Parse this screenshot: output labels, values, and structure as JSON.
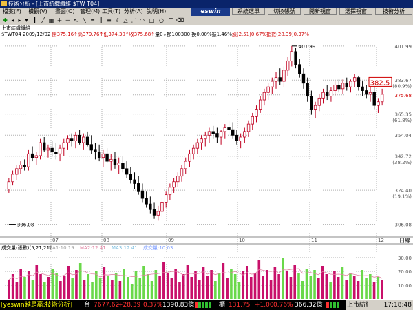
{
  "window": {
    "title": "技術分析 - [上市紡織纖維 $TW T04]"
  },
  "menu": {
    "items": [
      "檔案(F)",
      "橫觀(V)",
      "畫面(O)",
      "管理(M)",
      "工具(T)",
      "分析(A)",
      "說明(H)"
    ],
    "logo": "eswin",
    "right_buttons": [
      "系統選單",
      "切換帳號",
      "開新視窗",
      "選擇視窗",
      "技術分析"
    ]
  },
  "info": {
    "name": "上市紡織纖維",
    "line2": [
      {
        "t": "$TWT04 2009/12/02 ",
        "c": "k"
      },
      {
        "t": "開375.16↑",
        "c": "r"
      },
      {
        "t": "高379.76↑",
        "c": "r"
      },
      {
        "t": "低374.30↑",
        "c": "r"
      },
      {
        "t": "收375.68↑",
        "c": "r"
      },
      {
        "t": "量0↓",
        "c": "k"
      },
      {
        "t": "額100300 ",
        "c": "k"
      },
      {
        "t": "換0.00%",
        "c": "k"
      },
      {
        "t": "振1.46%",
        "c": "k"
      },
      {
        "t": "漲(2.51)0.67%",
        "c": "r"
      },
      {
        "t": "指數(28.39)0.37%",
        "c": "r"
      }
    ]
  },
  "chart_data": {
    "type": "candlestick",
    "price_axis": {
      "min": 306.08,
      "max": 401.99,
      "ticks": [
        "401.99",
        "383.67",
        "(80.9%)",
        "375.68",
        "365.35",
        "(61.8%)",
        "354.04",
        "342.72",
        "(38.2%)",
        "324.40",
        "(19.1%)",
        "306.08"
      ]
    },
    "annotations": {
      "high": "401.99",
      "low": "306.08",
      "current_box": "382.5"
    },
    "x_labels": [
      "07",
      "08",
      "09",
      "10",
      "11",
      "12"
    ],
    "x_axis_label": "日線",
    "volume_title": "成交量(張數)(5,21,21)",
    "volume_ma": [
      "MA1:10.19",
      "MA2:12.41",
      "MA3:12.41",
      "成交量:10.03"
    ],
    "volume_axis": [
      "30.00",
      "20.00",
      "10.00"
    ],
    "candles": [
      [
        325,
        331,
        323,
        329
      ],
      [
        329,
        335,
        327,
        333
      ],
      [
        333,
        338,
        330,
        336
      ],
      [
        336,
        340,
        333,
        338
      ],
      [
        338,
        341,
        335,
        337
      ],
      [
        337,
        346,
        335,
        344
      ],
      [
        344,
        348,
        340,
        342
      ],
      [
        342,
        345,
        338,
        343
      ],
      [
        343,
        352,
        341,
        350
      ],
      [
        350,
        353,
        345,
        346
      ],
      [
        346,
        349,
        342,
        347
      ],
      [
        347,
        351,
        343,
        345
      ],
      [
        345,
        350,
        341,
        344
      ],
      [
        344,
        349,
        340,
        347
      ],
      [
        347,
        352,
        343,
        350
      ],
      [
        350,
        354,
        346,
        352
      ],
      [
        352,
        355,
        348,
        351
      ],
      [
        351,
        356,
        347,
        354
      ],
      [
        354,
        357,
        349,
        350
      ],
      [
        350,
        355,
        346,
        353
      ],
      [
        353,
        356,
        348,
        349
      ],
      [
        349,
        354,
        344,
        346
      ],
      [
        346,
        350,
        341,
        345
      ],
      [
        345,
        349,
        340,
        342
      ],
      [
        342,
        346,
        337,
        344
      ],
      [
        344,
        347,
        339,
        340
      ],
      [
        340,
        344,
        335,
        341
      ],
      [
        341,
        345,
        336,
        338
      ],
      [
        338,
        342,
        333,
        339
      ],
      [
        339,
        343,
        334,
        336
      ],
      [
        336,
        340,
        331,
        333
      ],
      [
        333,
        337,
        328,
        330
      ],
      [
        330,
        334,
        325,
        328
      ],
      [
        328,
        332,
        322,
        324
      ],
      [
        324,
        328,
        318,
        320
      ],
      [
        320,
        324,
        315,
        317
      ],
      [
        317,
        321,
        312,
        314
      ],
      [
        314,
        318,
        309,
        311
      ],
      [
        311,
        316,
        308,
        313
      ],
      [
        313,
        320,
        310,
        318
      ],
      [
        318,
        324,
        315,
        322
      ],
      [
        322,
        328,
        319,
        326
      ],
      [
        326,
        331,
        323,
        329
      ],
      [
        329,
        334,
        326,
        332
      ],
      [
        332,
        338,
        329,
        336
      ],
      [
        336,
        342,
        333,
        340
      ],
      [
        340,
        346,
        337,
        344
      ],
      [
        344,
        349,
        341,
        347
      ],
      [
        347,
        352,
        344,
        350
      ],
      [
        350,
        354,
        346,
        352
      ],
      [
        352,
        356,
        348,
        354
      ],
      [
        354,
        358,
        350,
        356
      ],
      [
        356,
        359,
        352,
        355
      ],
      [
        355,
        358,
        350,
        353
      ],
      [
        353,
        357,
        349,
        356
      ],
      [
        356,
        360,
        352,
        358
      ],
      [
        358,
        362,
        354,
        357
      ],
      [
        357,
        361,
        352,
        354
      ],
      [
        354,
        357,
        349,
        351
      ],
      [
        351,
        355,
        347,
        353
      ],
      [
        353,
        358,
        350,
        356
      ],
      [
        356,
        362,
        353,
        360
      ],
      [
        360,
        366,
        357,
        364
      ],
      [
        364,
        370,
        361,
        368
      ],
      [
        368,
        375,
        366,
        373
      ],
      [
        373,
        379,
        370,
        377
      ],
      [
        377,
        382,
        373,
        380
      ],
      [
        380,
        385,
        376,
        383
      ],
      [
        383,
        388,
        379,
        385
      ],
      [
        385,
        390,
        381,
        383
      ],
      [
        383,
        391,
        380,
        389
      ],
      [
        389,
        396,
        386,
        394
      ],
      [
        394,
        402,
        391,
        399
      ],
      [
        399,
        401,
        390,
        392
      ],
      [
        392,
        395,
        385,
        387
      ],
      [
        387,
        390,
        379,
        382
      ],
      [
        382,
        385,
        372,
        375
      ],
      [
        375,
        378,
        365,
        368
      ],
      [
        368,
        372,
        363,
        370
      ],
      [
        370,
        376,
        367,
        374
      ],
      [
        374,
        379,
        371,
        377
      ],
      [
        377,
        381,
        373,
        375
      ],
      [
        375,
        380,
        372,
        378
      ],
      [
        378,
        383,
        375,
        381
      ],
      [
        381,
        384,
        377,
        379
      ],
      [
        379,
        384,
        376,
        382
      ],
      [
        382,
        385,
        378,
        380
      ],
      [
        380,
        384,
        377,
        383
      ],
      [
        383,
        387,
        380,
        385
      ],
      [
        385,
        386,
        378,
        380
      ],
      [
        380,
        383,
        375,
        378
      ],
      [
        378,
        381,
        374,
        376
      ],
      [
        376,
        380,
        372,
        377
      ],
      [
        377,
        381,
        368,
        370
      ],
      [
        370,
        374,
        366,
        372
      ],
      [
        372,
        379,
        370,
        376
      ]
    ],
    "volumes": [
      14,
      18,
      12,
      22,
      16,
      20,
      14,
      25,
      18,
      12,
      16,
      22,
      19,
      13,
      17,
      24,
      15,
      21,
      26,
      14,
      18,
      12,
      20,
      15,
      23,
      17,
      14,
      19,
      13,
      22,
      16,
      11,
      20,
      15,
      24,
      18,
      13,
      21,
      17,
      27,
      19,
      15,
      22,
      12,
      18,
      25,
      16,
      20,
      14,
      23,
      17,
      21,
      13,
      19,
      26,
      15,
      22,
      18,
      12,
      20,
      24,
      16,
      19,
      28,
      17,
      21,
      14,
      23,
      18,
      30,
      20,
      16,
      25,
      19,
      13,
      22,
      17,
      21,
      15,
      24,
      18,
      12,
      20,
      16,
      23,
      14,
      19,
      17,
      13,
      21,
      15,
      18,
      12,
      16,
      14
    ]
  },
  "status": {
    "brand": "[yeswin越是贏:技術分析]",
    "a_label": "台",
    "a_value": "7677.62",
    "a_change": "+28.39",
    "a_pct": "0.37%",
    "a_amount": "1390.83億",
    "b_label": "櫃",
    "b_value": "131.75",
    "b_change": "+1.00",
    "b_pct": "0.76%",
    "b_amount": "366.32億",
    "tab": "上市紡織",
    "time": "17:18:48"
  },
  "colors": {
    "up": "#c00020",
    "down": "#000000",
    "vol_up": "#c8106a",
    "vol_down": "#6ad84a",
    "grid": "#b0b0b0"
  }
}
